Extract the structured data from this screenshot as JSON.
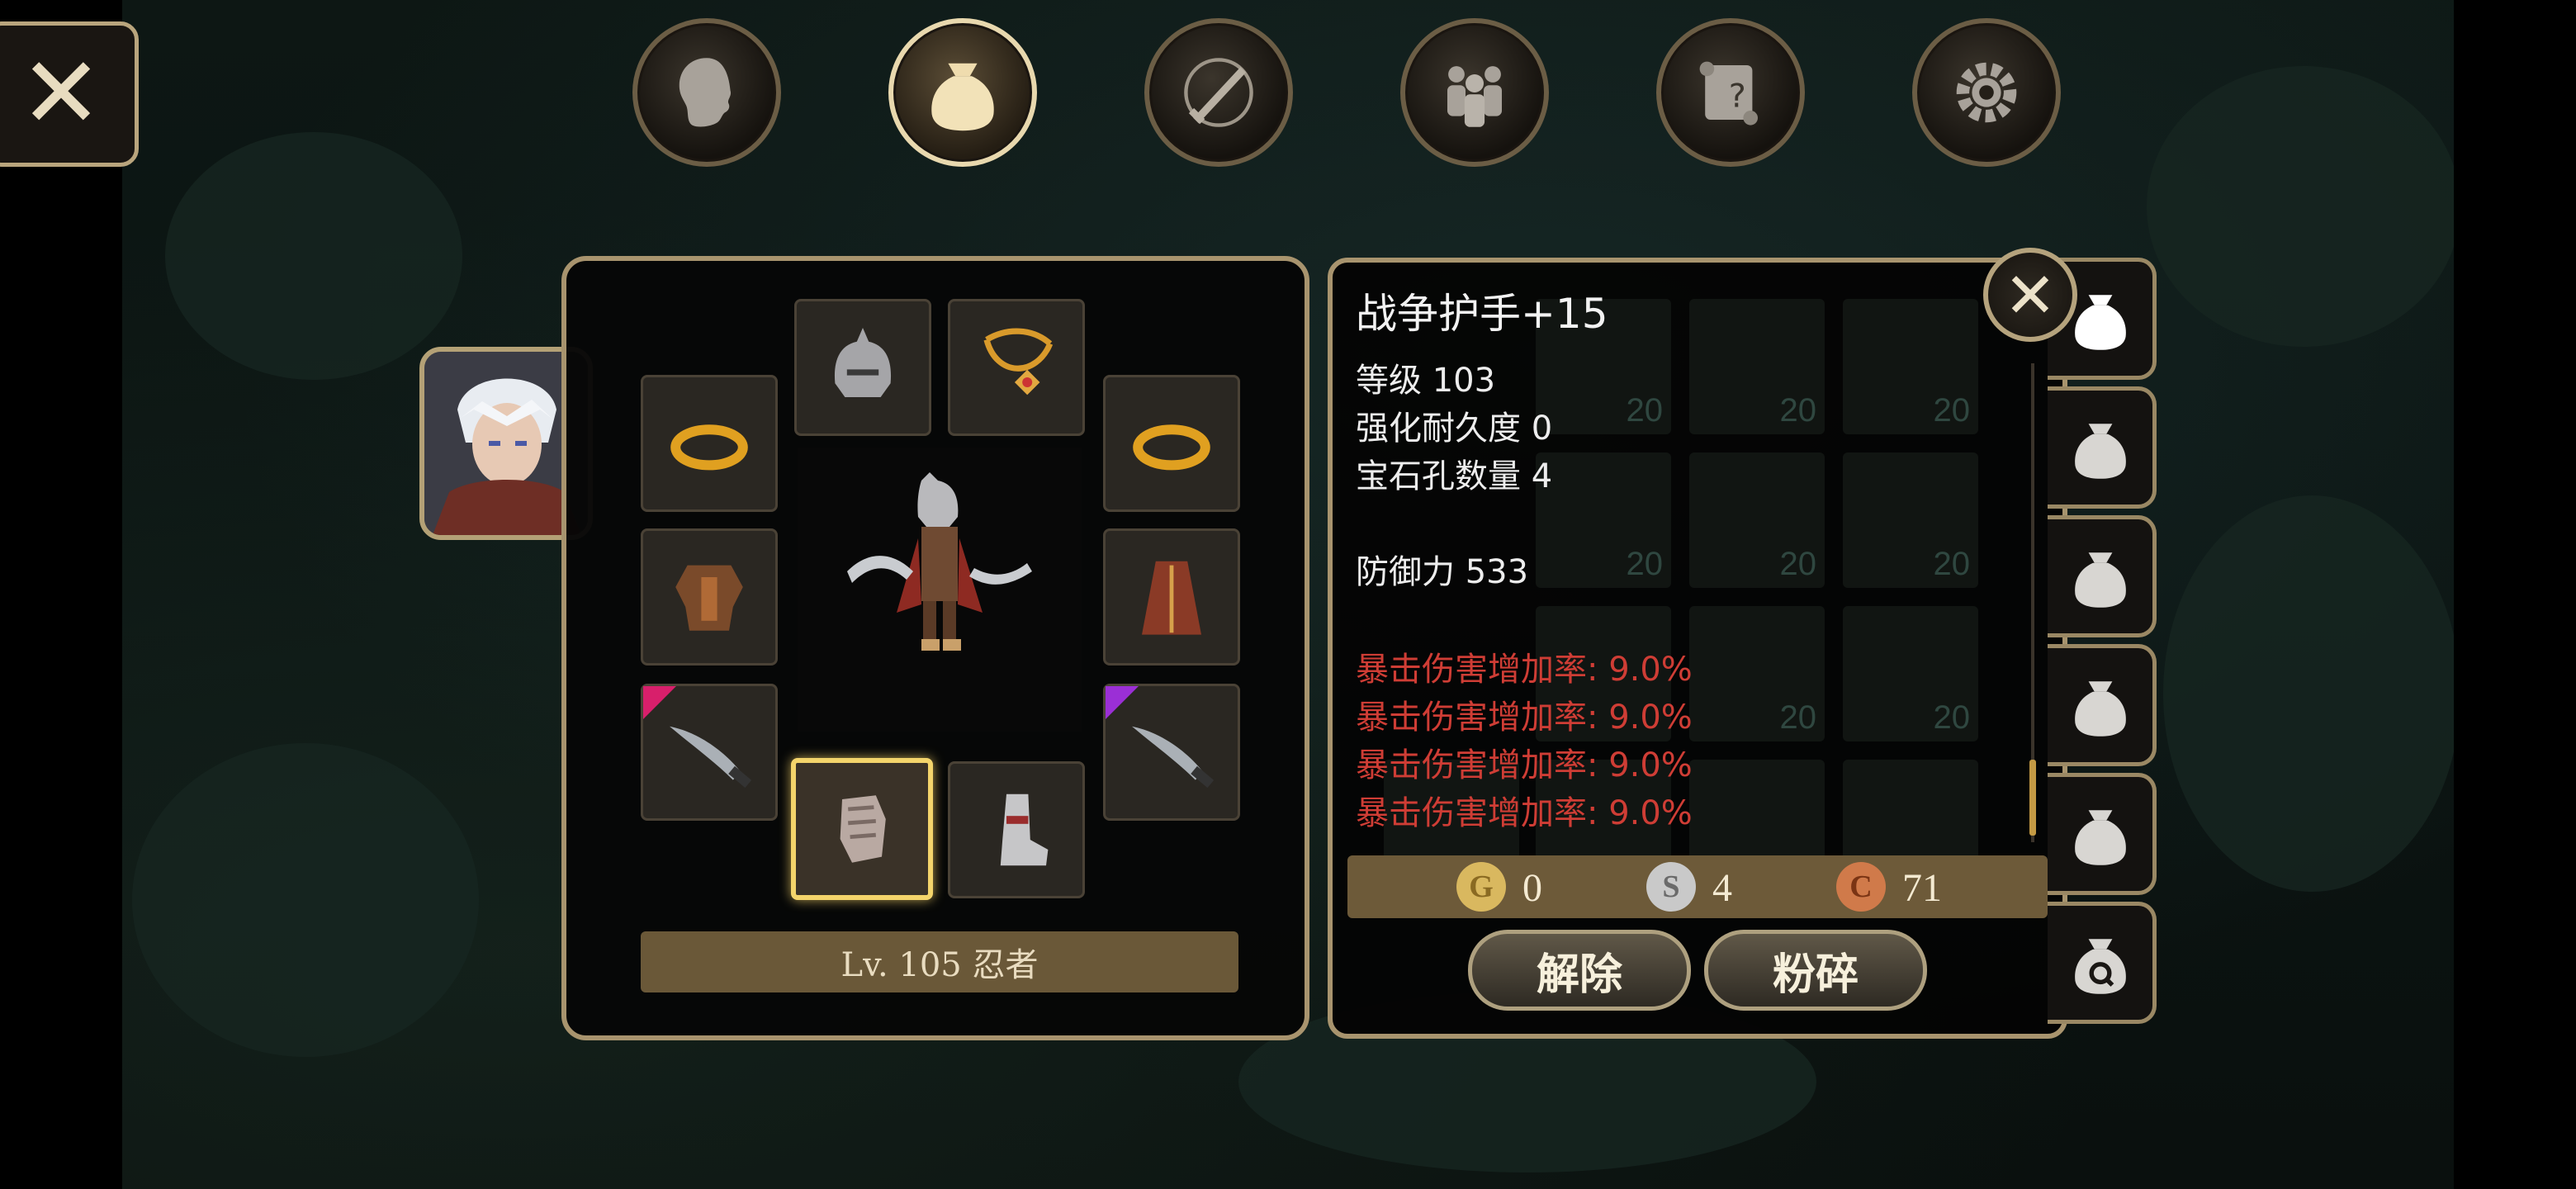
{
  "window": {
    "close_glyph": "✕"
  },
  "topnav": {
    "tabs": [
      {
        "name": "character",
        "icon": "head-icon",
        "active": false
      },
      {
        "name": "inventory",
        "icon": "bag-icon",
        "active": true
      },
      {
        "name": "skills",
        "icon": "sword-compass-icon",
        "active": false
      },
      {
        "name": "party",
        "icon": "group-icon",
        "active": false
      },
      {
        "name": "quests",
        "icon": "scroll-icon",
        "active": false
      },
      {
        "name": "settings",
        "icon": "gear-icon",
        "active": false
      }
    ]
  },
  "equipment": {
    "slots": [
      {
        "name": "helmet",
        "icon": "helmet-icon"
      },
      {
        "name": "necklace",
        "icon": "necklace-icon"
      },
      {
        "name": "ring-left",
        "icon": "ring-icon"
      },
      {
        "name": "ring-right",
        "icon": "ring-icon"
      },
      {
        "name": "armor",
        "icon": "armor-icon"
      },
      {
        "name": "cloak",
        "icon": "cloak-icon"
      },
      {
        "name": "weapon-left",
        "icon": "dagger-icon"
      },
      {
        "name": "weapon-right",
        "icon": "dagger-icon"
      },
      {
        "name": "gloves",
        "icon": "gauntlet-icon",
        "selected": true
      },
      {
        "name": "boots",
        "icon": "boot-icon"
      }
    ],
    "level_label": "Lv. 105 忍者"
  },
  "item": {
    "title": "战争护手+15",
    "stats": [
      "等级 103",
      "强化耐久度 0",
      "宝石孔数量 4",
      "防御力 533"
    ],
    "bonuses": [
      "暴击伤害增加率: 9.0%",
      "暴击伤害增加率: 9.0%",
      "暴击伤害增加率: 9.0%",
      "暴击伤害增加率: 9.0%"
    ],
    "ghost_counts": [
      "20",
      "20",
      "20",
      "20",
      "20",
      "20",
      "20",
      "20",
      "20"
    ]
  },
  "currency": {
    "gold": {
      "symbol": "G",
      "value": "0",
      "color": "#d9b85f"
    },
    "silver": {
      "symbol": "S",
      "value": "4",
      "color": "#c9c9c9"
    },
    "copper": {
      "symbol": "C",
      "value": "71",
      "color": "#d07a4a"
    }
  },
  "actions": {
    "unequip_label": "解除",
    "shatter_label": "粉碎"
  },
  "colors": {
    "panel_border": "#a8946e",
    "bonus_text": "#cf3d35",
    "level_bar": "#6a5838"
  }
}
